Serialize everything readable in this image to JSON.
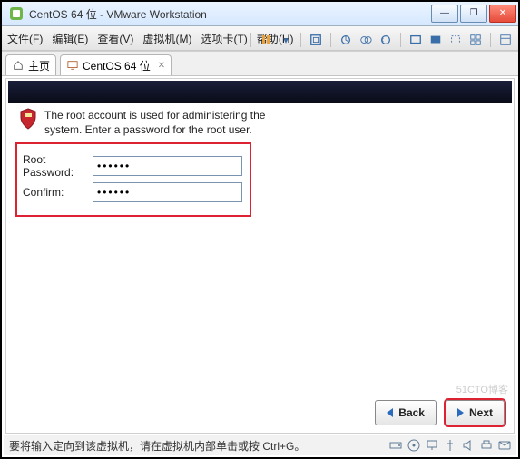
{
  "window": {
    "title": "CentOS 64 位 - VMware Workstation",
    "buttons": {
      "min": "—",
      "max": "❐",
      "close": "✕"
    }
  },
  "menu": {
    "file": {
      "label": "文件",
      "key": "F"
    },
    "edit": {
      "label": "编辑",
      "key": "E"
    },
    "view": {
      "label": "查看",
      "key": "V"
    },
    "vm": {
      "label": "虚拟机",
      "key": "M"
    },
    "tabs": {
      "label": "选项卡",
      "key": "T"
    },
    "help": {
      "label": "帮助",
      "key": "H"
    }
  },
  "tabs": {
    "home": {
      "label": "主页"
    },
    "centos": {
      "label": "CentOS 64 位",
      "close": "✕"
    }
  },
  "installer": {
    "icon_alt": "shield-icon",
    "message": "The root account is used for administering the system.  Enter a password for the root user.",
    "root_label": "Root Password:",
    "confirm_label": "Confirm:",
    "root_value": "••••••",
    "confirm_value": "••••••",
    "back": "Back",
    "next": "Next"
  },
  "status": {
    "text": "要将输入定向到该虚拟机，请在虚拟机内部单击或按 Ctrl+G。"
  },
  "watermark": "51CTO博客"
}
